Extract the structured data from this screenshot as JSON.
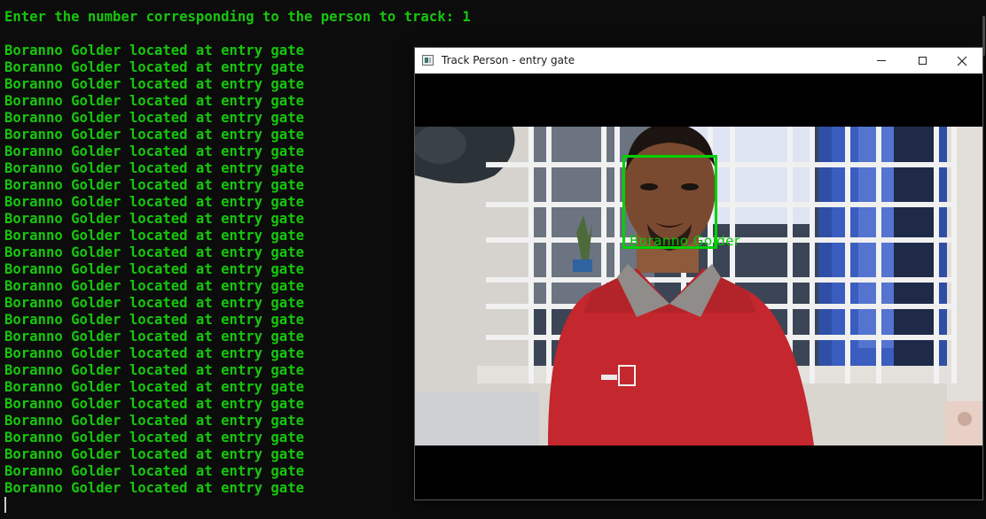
{
  "terminal": {
    "prompt": "Enter the number corresponding to the person to track: 1",
    "lines": [
      "Boranno Golder located at entry gate",
      "Boranno Golder located at entry gate",
      "Boranno Golder located at entry gate",
      "Boranno Golder located at entry gate",
      "Boranno Golder located at entry gate",
      "Boranno Golder located at entry gate",
      "Boranno Golder located at entry gate",
      "Boranno Golder located at entry gate",
      "Boranno Golder located at entry gate",
      "Boranno Golder located at entry gate",
      "Boranno Golder located at entry gate",
      "Boranno Golder located at entry gate",
      "Boranno Golder located at entry gate",
      "Boranno Golder located at entry gate",
      "Boranno Golder located at entry gate",
      "Boranno Golder located at entry gate",
      "Boranno Golder located at entry gate",
      "Boranno Golder located at entry gate",
      "Boranno Golder located at entry gate",
      "Boranno Golder located at entry gate",
      "Boranno Golder located at entry gate",
      "Boranno Golder located at entry gate",
      "Boranno Golder located at entry gate",
      "Boranno Golder located at entry gate",
      "Boranno Golder located at entry gate",
      "Boranno Golder located at entry gate",
      "Boranno Golder located at entry gate"
    ]
  },
  "window": {
    "title": "Track Person - entry gate",
    "icon": "app-window-icon",
    "controls": {
      "minimize_icon": "minimize-icon",
      "maximize_icon": "maximize-icon",
      "close_icon": "close-icon",
      "close_glyph": "✕"
    }
  },
  "detection": {
    "label": "Boranno Golder",
    "box_color": "#00d000"
  },
  "colors": {
    "terminal_bg": "#0c0c0c",
    "terminal_text": "#16c60c",
    "window_bg": "#000000",
    "titlebar_bg": "#ffffff"
  }
}
